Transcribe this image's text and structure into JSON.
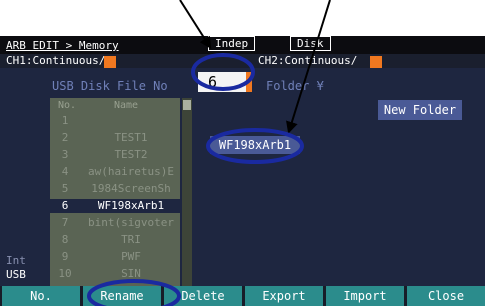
{
  "header": {
    "path": "ARB EDIT > Memory",
    "indep_label": "Indep",
    "disk_label": "Disk",
    "ch1_label": "CH1:Continuous/",
    "ch2_label": "CH2:Continuous/"
  },
  "usb_panel": {
    "title": "USB Disk File No",
    "file_no_value": "6",
    "folder_label": "Folder ¥",
    "new_folder_label": "New Folder",
    "selected_file_name": "WF198xArb1",
    "columns": {
      "no": "No.",
      "name": "Name"
    },
    "rows": [
      {
        "no": "1",
        "name": ""
      },
      {
        "no": "2",
        "name": "TEST1"
      },
      {
        "no": "3",
        "name": "TEST2"
      },
      {
        "no": "4",
        "name": "aw(hairetus)E"
      },
      {
        "no": "5",
        "name": "1984ScreenSh"
      },
      {
        "no": "6",
        "name": "WF198xArb1"
      },
      {
        "no": "7",
        "name": "bint(sigvoter"
      },
      {
        "no": "8",
        "name": "TRI"
      },
      {
        "no": "9",
        "name": "PWF"
      },
      {
        "no": "10",
        "name": "SIN"
      }
    ],
    "selected_index": 5
  },
  "side_labels": {
    "int": "Int",
    "usb": "USB"
  },
  "softkeys": [
    "No.",
    "Rename",
    "Delete",
    "Export",
    "Import",
    "Close"
  ],
  "colors": {
    "accent": "#f07820",
    "softkey": "#2b8c8c",
    "highlight_ring": "#1a2aa0",
    "panel": "#1e2640"
  },
  "icons": [
    "down-arrow-icon",
    "highlight-ellipse-icon"
  ]
}
